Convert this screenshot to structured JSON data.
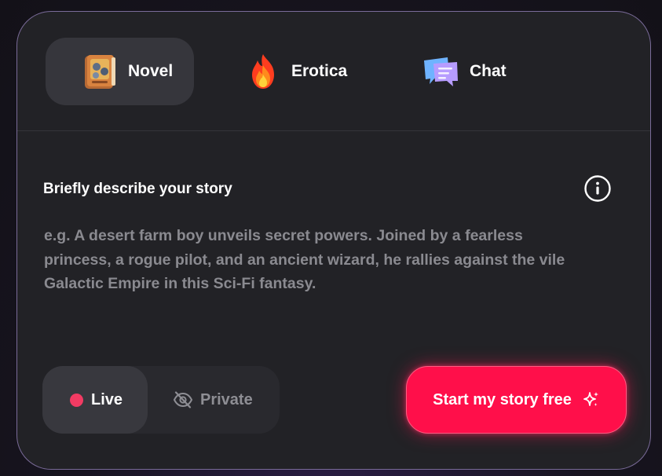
{
  "tabs": [
    {
      "label": "Novel",
      "icon": "book-emoji-icon",
      "active": true
    },
    {
      "label": "Erotica",
      "icon": "fire-emoji-icon",
      "active": false
    },
    {
      "label": "Chat",
      "icon": "chat-bubbles-emoji-icon",
      "active": false
    }
  ],
  "prompt": {
    "label": "Briefly describe your story",
    "placeholder": "e.g. A desert farm boy unveils secret powers. Joined by a fearless princess, a rogue pilot, and an ancient wizard, he rallies against the vile Galactic Empire in this Sci-Fi fantasy.",
    "value": "",
    "info_icon": "info-icon"
  },
  "visibility": {
    "options": [
      {
        "label": "Live",
        "icon": "live-dot-icon",
        "selected": true
      },
      {
        "label": "Private",
        "icon": "eye-off-icon",
        "selected": false
      }
    ]
  },
  "actions": {
    "start_label": "Start my story free",
    "start_icon": "sparkle-icon"
  },
  "colors": {
    "accent": "#ff0f4a",
    "card_bg": "#222226",
    "card_border": "#7a6b99",
    "live_dot": "#f23b63"
  }
}
